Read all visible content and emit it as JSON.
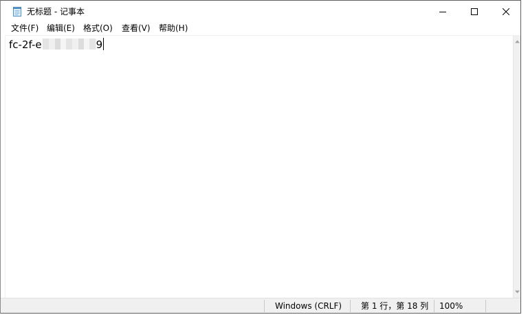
{
  "window": {
    "title": "无标题 - 记事本"
  },
  "menu": {
    "items": [
      {
        "label": "文件(F)"
      },
      {
        "label": "编辑(E)"
      },
      {
        "label": "格式(O)"
      },
      {
        "label": "查看(V)"
      },
      {
        "label": "帮助(H)"
      }
    ]
  },
  "editor": {
    "text_prefix": "fc-2f-e",
    "text_suffix": "9"
  },
  "statusbar": {
    "line_ending": "Windows (CRLF)",
    "position": "第 1 行，第 18 列",
    "zoom": "100%"
  },
  "icons": {
    "app": "notepad-icon",
    "minimize": "minimize-icon",
    "maximize": "maximize-icon",
    "close": "close-icon",
    "scroll_up": "chevron-up-icon",
    "scroll_down": "chevron-down-icon"
  },
  "colors": {
    "window_border": "#5f5f5f",
    "statusbar_bg": "#f0f0f0",
    "scrollbar_bg": "#f0f0f0"
  }
}
